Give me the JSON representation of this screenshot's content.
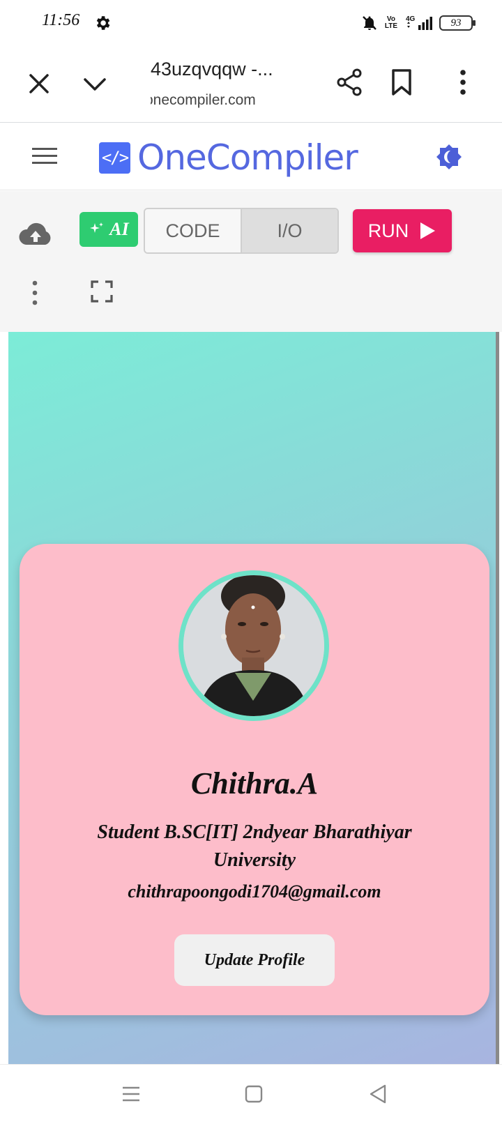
{
  "status_bar": {
    "time": "11:56",
    "network": {
      "volte_top": "Vo",
      "volte_bottom": "LTE",
      "type": "4G"
    },
    "battery": "93"
  },
  "browser": {
    "page_title": "43uzqvqqw -...",
    "url": "onecompiler.com"
  },
  "site_header": {
    "logo_mark": "</>",
    "logo_text": "OneCompiler"
  },
  "toolbar": {
    "ai_label": "AI",
    "tabs": [
      {
        "label": "CODE",
        "selected": false
      },
      {
        "label": "I/O",
        "selected": true
      }
    ],
    "run_label": "RUN"
  },
  "profile_card": {
    "name": "Chithra.A",
    "role": "Student B.SC[IT] 2ndyear Bharathiyar University",
    "email": "chithrapoongodi1704@gmail.com",
    "button_label": "Update Profile"
  },
  "colors": {
    "brand": "#5568e0",
    "run": "#e91e63",
    "ai": "#2ecc71",
    "card": "#fdbdca",
    "avatar_ring": "#6ee2c8"
  }
}
